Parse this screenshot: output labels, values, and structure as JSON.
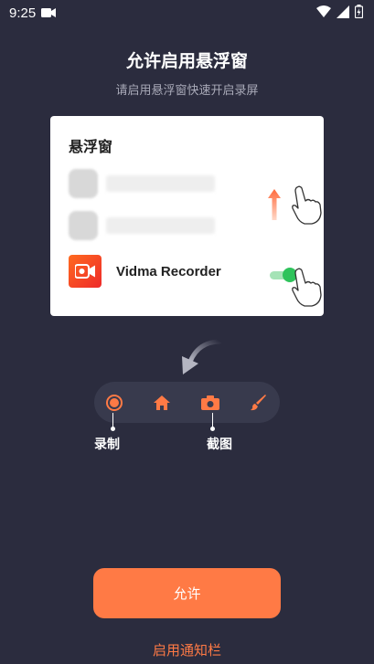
{
  "status_bar": {
    "time": "9:25",
    "icons": [
      "video-record-icon",
      "wifi-icon",
      "signal-icon",
      "battery-charging-icon"
    ]
  },
  "header": {
    "title": "允许启用悬浮窗",
    "subtitle": "请启用悬浮窗快速开启录屏"
  },
  "card": {
    "title": "悬浮窗",
    "app_name": "Vidma Recorder",
    "toggle_on": true
  },
  "toolbar": {
    "buttons": [
      "record-icon",
      "home-icon",
      "camera-icon",
      "brush-icon"
    ],
    "record_label": "录制",
    "screenshot_label": "截图"
  },
  "actions": {
    "allow_label": "允许",
    "notification_link": "启用通知栏"
  },
  "colors": {
    "background": "#2b2c3e",
    "accent": "#ff7a45",
    "toggle_green": "#2ec35b",
    "toolbar_bg": "#383a4d"
  }
}
